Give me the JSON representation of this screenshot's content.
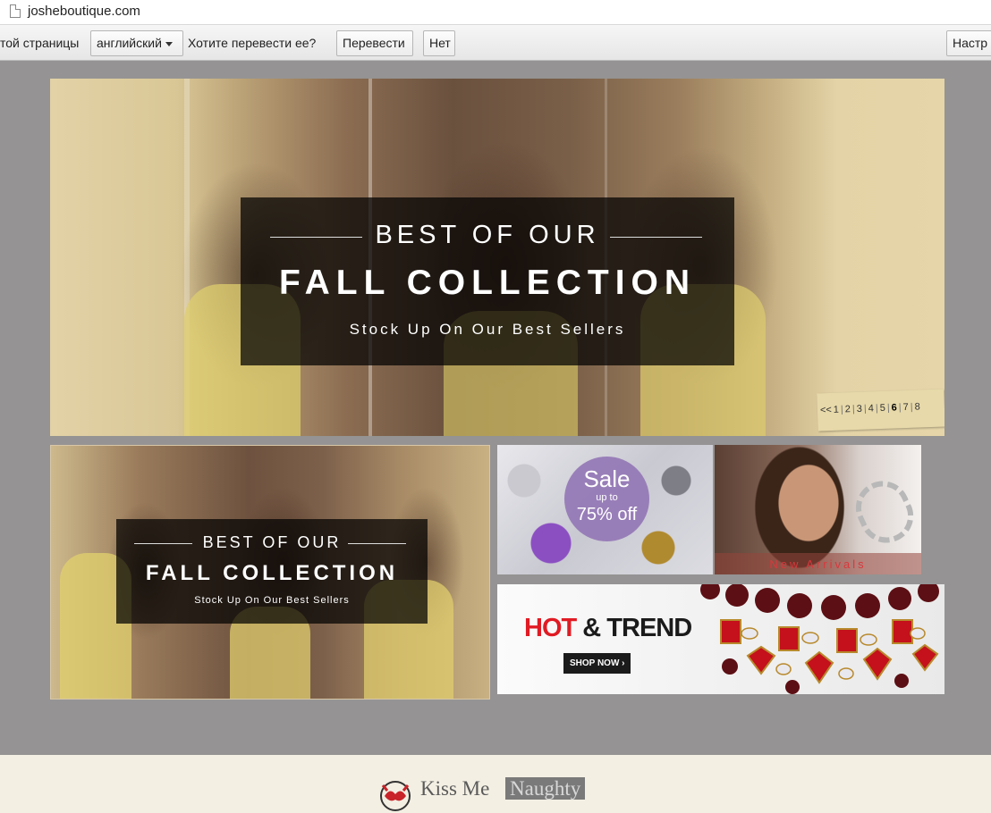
{
  "browser": {
    "url": "josheboutique.com"
  },
  "translate_bar": {
    "prefix": "той страницы",
    "language": "английский",
    "question": "Хотите перевести ее?",
    "translate_label": "Перевести",
    "no_label": "Нет",
    "settings_label": "Настр"
  },
  "hero": {
    "line1": "BEST OF OUR",
    "line2": "FALL COLLECTION",
    "line3": "Stock Up On Our Best Sellers",
    "pager": {
      "prev": "<<",
      "pages": [
        "1",
        "2",
        "3",
        "4",
        "5",
        "6",
        "7",
        "8"
      ],
      "current": "6"
    }
  },
  "small_banner": {
    "line1": "BEST OF OUR",
    "line2": "FALL COLLECTION",
    "line3": "Stock Up On Our Best Sellers"
  },
  "sale_banner": {
    "sale": "Sale",
    "up_to": "up to",
    "discount": "75% off"
  },
  "arrivals_banner": {
    "label": "New Arrivals"
  },
  "hot_banner": {
    "hot": "HOT",
    "rest": "& TREND",
    "button": "SHOP NOW ›"
  },
  "footer": {
    "logo_text": "Kiss Me",
    "logo_highlight": "Naughty"
  },
  "colors": {
    "page_bg": "#959393",
    "hot_red": "#e01b24",
    "sale_purple": "#9276b5"
  }
}
